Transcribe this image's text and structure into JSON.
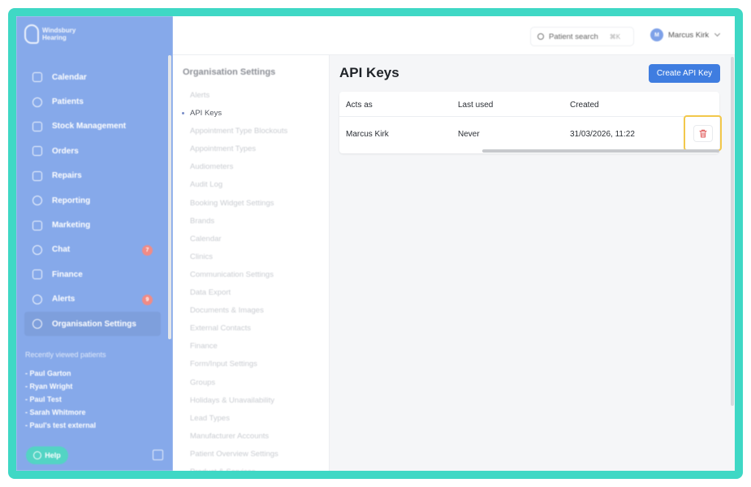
{
  "brand": {
    "name_line1": "Windsbury",
    "name_line2": "Hearing"
  },
  "sidebar": {
    "items": [
      {
        "label": "Calendar",
        "icon": "calendar-icon"
      },
      {
        "label": "Patients",
        "icon": "patients-icon"
      },
      {
        "label": "Stock Management",
        "icon": "clipboard-icon"
      },
      {
        "label": "Orders",
        "icon": "orders-icon"
      },
      {
        "label": "Repairs",
        "icon": "wrench-icon"
      },
      {
        "label": "Reporting",
        "icon": "chart-icon"
      },
      {
        "label": "Marketing",
        "icon": "mail-icon"
      },
      {
        "label": "Chat",
        "icon": "chat-icon",
        "badge": "7"
      },
      {
        "label": "Finance",
        "icon": "card-icon"
      },
      {
        "label": "Alerts",
        "icon": "bell-icon",
        "badge": "9"
      },
      {
        "label": "Organisation Settings",
        "icon": "gear-icon",
        "active": true
      }
    ],
    "recent_title": "Recently viewed patients",
    "recent": [
      "- Paul Garton",
      "- Ryan Wright",
      "- Paul Test",
      "- Sarah Whitmore",
      "- Paul's test external"
    ],
    "help_label": "Help"
  },
  "topbar": {
    "search_label": "Patient search",
    "search_shortcut": "⌘K",
    "user_initials": "M",
    "user_name": "Marcus Kirk"
  },
  "settings": {
    "title": "Organisation Settings",
    "items": [
      "Alerts",
      "API Keys",
      "Appointment Type Blockouts",
      "Appointment Types",
      "Audiometers",
      "Audit Log",
      "Booking Widget Settings",
      "Brands",
      "Calendar",
      "Clinics",
      "Communication Settings",
      "Data Export",
      "Documents & Images",
      "External Contacts",
      "Finance",
      "Form/Input Settings",
      "Groups",
      "Holidays & Unavailability",
      "Lead Types",
      "Manufacturer Accounts",
      "Patient Overview Settings",
      "Product & Services"
    ],
    "active_index": 1
  },
  "main": {
    "title": "API Keys",
    "create_label": "Create API Key",
    "columns": [
      "Acts as",
      "Last used",
      "Created"
    ],
    "rows": [
      {
        "acts_as": "Marcus Kirk",
        "last_used": "Never",
        "created": "31/03/2026, 11:22"
      }
    ]
  },
  "colors": {
    "sidebar": "#86a9ea",
    "frame": "#3fd8c5",
    "primary": "#3f7de0",
    "delete": "#e05a5a",
    "highlight": "#f2c84b"
  }
}
